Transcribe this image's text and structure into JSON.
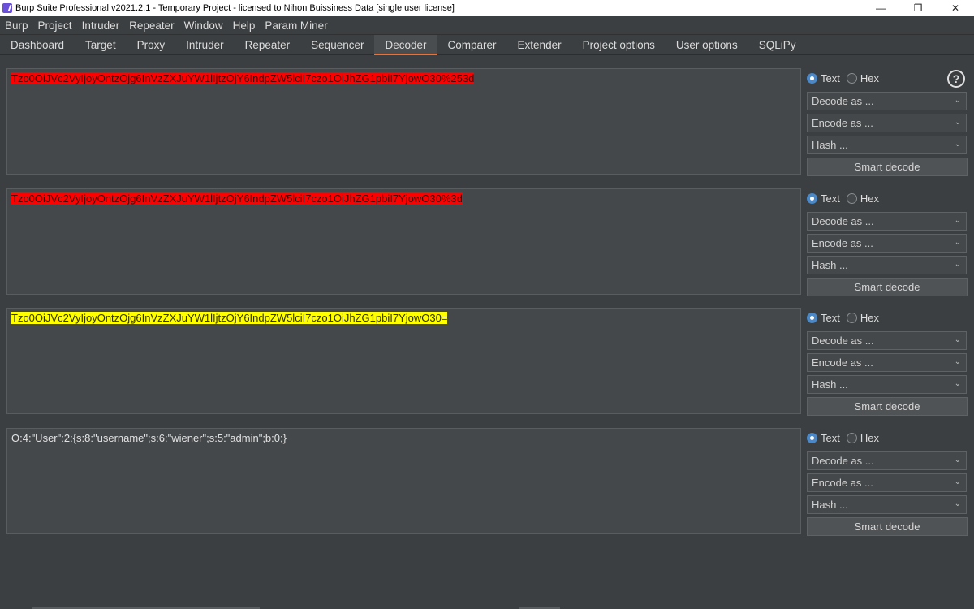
{
  "window": {
    "title": "Burp Suite Professional v2021.2.1 - Temporary Project - licensed to Nihon Buissiness Data [single user license]",
    "controls": [
      "—",
      "❐",
      "✕"
    ]
  },
  "menubar": [
    "Burp",
    "Project",
    "Intruder",
    "Repeater",
    "Window",
    "Help",
    "Param Miner"
  ],
  "tabs": [
    {
      "label": "Dashboard",
      "active": false
    },
    {
      "label": "Target",
      "active": false
    },
    {
      "label": "Proxy",
      "active": false
    },
    {
      "label": "Intruder",
      "active": false
    },
    {
      "label": "Repeater",
      "active": false
    },
    {
      "label": "Sequencer",
      "active": false
    },
    {
      "label": "Decoder",
      "active": true
    },
    {
      "label": "Comparer",
      "active": false
    },
    {
      "label": "Extender",
      "active": false
    },
    {
      "label": "Project options",
      "active": false
    },
    {
      "label": "User options",
      "active": false
    },
    {
      "label": "SQLiPy",
      "active": false
    }
  ],
  "colors": {
    "highlight_red": "#ff0000",
    "highlight_yellow": "#ffff00",
    "active_tab_accent": "#e8743b"
  },
  "decoder": {
    "help_icon": "?",
    "panes": [
      {
        "text": "Tzo0OiJVc2VyIjoyOntzOjg6InVzZXJuYW1lIjtzOjY6IndpZW5lciI7czo1OiJhZG1pbiI7YjowO30%253d",
        "highlight": "red",
        "mode_text": "Text",
        "mode_hex": "Hex",
        "selected_mode": "Text",
        "decode_as": "Decode as ...",
        "encode_as": "Encode as ...",
        "hash": "Hash ...",
        "smart_decode": "Smart decode"
      },
      {
        "text": "Tzo0OiJVc2VyIjoyOntzOjg6InVzZXJuYW1lIjtzOjY6IndpZW5lciI7czo1OiJhZG1pbiI7YjowO30%3d",
        "highlight": "red",
        "mode_text": "Text",
        "mode_hex": "Hex",
        "selected_mode": "Text",
        "decode_as": "Decode as ...",
        "encode_as": "Encode as ...",
        "hash": "Hash ...",
        "smart_decode": "Smart decode"
      },
      {
        "text": "Tzo0OiJVc2VyIjoyOntzOjg6InVzZXJuYW1lIjtzOjY6IndpZW5lciI7czo1OiJhZG1pbiI7YjowO30=",
        "highlight": "yellow",
        "mode_text": "Text",
        "mode_hex": "Hex",
        "selected_mode": "Text",
        "decode_as": "Decode as ...",
        "encode_as": "Encode as ...",
        "hash": "Hash ...",
        "smart_decode": "Smart decode"
      },
      {
        "text": "O:4:\"User\":2:{s:8:\"username\";s:6:\"wiener\";s:5:\"admin\";b:0;}",
        "highlight": "none",
        "mode_text": "Text",
        "mode_hex": "Hex",
        "selected_mode": "Text",
        "decode_as": "Decode as ...",
        "encode_as": "Encode as ...",
        "hash": "Hash ...",
        "smart_decode": "Smart decode"
      }
    ]
  }
}
